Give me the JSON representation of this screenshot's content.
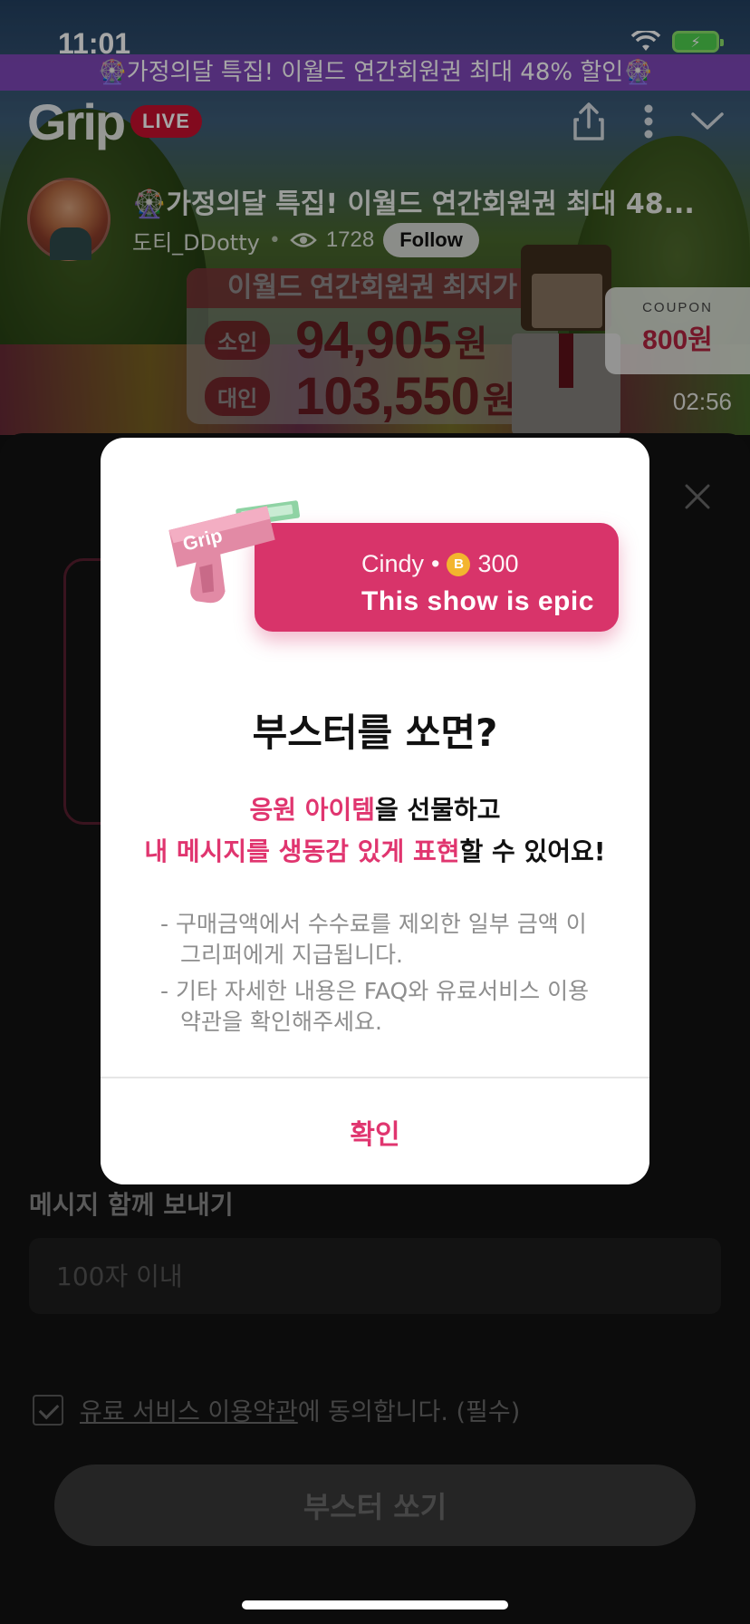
{
  "status_bar": {
    "time": "11:01"
  },
  "promo_bar": {
    "text": "🎡가정의달 특집! 이월드 연간회원권 최대 48% 할인🎡"
  },
  "header": {
    "logo": "Grip",
    "live_badge": "LIVE"
  },
  "stream": {
    "title": "🎡가정의달 특집! 이월드 연간회원권 최대 48...",
    "streamer": "도티_DDotty",
    "separator": "•",
    "viewers": "1728",
    "follow_label": "Follow",
    "timer": "02:56"
  },
  "promo_video": {
    "headline": "이월드 연간회원권 최저가",
    "rows": [
      {
        "tag": "소인",
        "price": "94,905",
        "unit": "원"
      },
      {
        "tag": "대인",
        "price": "103,550",
        "unit": "원"
      }
    ],
    "coupon_label": "COUPON",
    "coupon_value": "800원"
  },
  "modal": {
    "bubble_user": "Cindy",
    "bubble_sep": "•",
    "coin_symbol": "B",
    "bubble_amount": "300",
    "bubble_message": "This show is epic",
    "title": "부스터를 쏘면?",
    "lead_line1_pink": "응원 아이템",
    "lead_line1_rest": "을 선물하고",
    "lead_line2_pink": "내 메시지를 생동감 있게 표현",
    "lead_line2_rest": "할 수 있어요!",
    "notes": [
      "- 구매금액에서 수수료를 제외한 일부 금액 이 그리퍼에게 지급됩니다.",
      "- 기타 자세한 내용은 FAQ와 유료서비스 이용약관을 확인해주세요."
    ],
    "confirm_label": "확인"
  },
  "sheet": {
    "message_label": "메시지 함께 보내기",
    "message_placeholder": "100자 이내",
    "agree_link": "유료 서비스 이용약관",
    "agree_rest": "에 동의합니다. (필수)",
    "send_label": "부스터 쏘기"
  },
  "colors": {
    "accent": "#e0356f",
    "live": "#c8102e",
    "promo": "#8546be"
  }
}
